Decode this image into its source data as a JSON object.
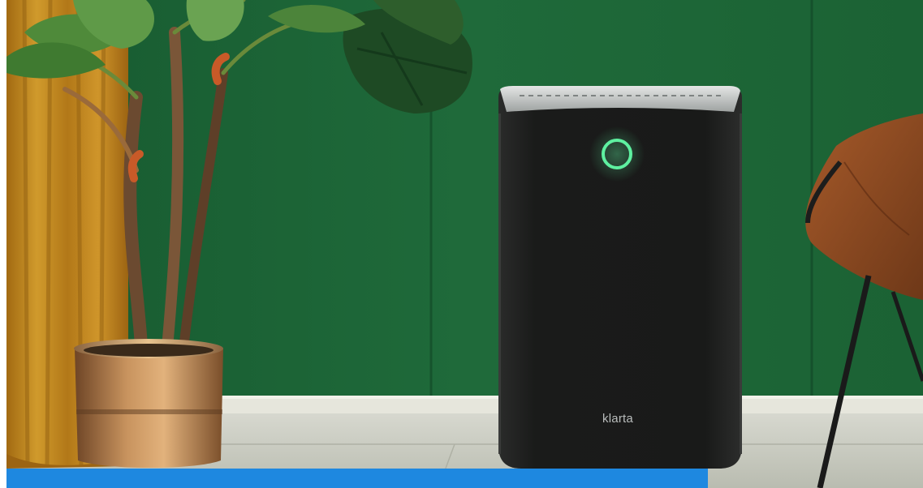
{
  "product": {
    "brand_label": "klarta"
  },
  "colors": {
    "wall": "#1f6a3a",
    "curtain": "#c48a1c",
    "device_body": "#1c1d1c",
    "device_top": "#c9cccb",
    "ring_light": "#5ef0a0",
    "pot": "#b07a48",
    "chair_seat": "#8a4a22",
    "caption_bar": "#1e88e0"
  },
  "icons": {
    "status_ring": "power-ring-icon"
  }
}
